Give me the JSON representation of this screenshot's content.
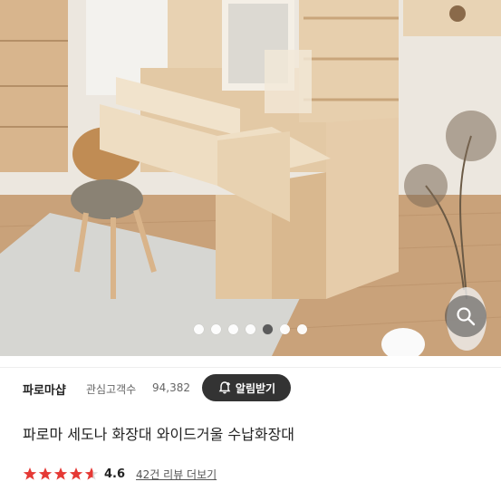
{
  "gallery": {
    "image_alt": "product-photo",
    "page_count": 7,
    "active_index": 4
  },
  "shop": {
    "name": "파로마샵",
    "fans_label": "관심고객수",
    "fans_count": "94,382",
    "alert_button_label": "알림받기"
  },
  "product": {
    "title": "파로마 세도나 화장대 와이드거울 수납화장대",
    "rating": "4.6",
    "rating_value": 4.6,
    "reviews_label": "42건 리뷰 더보기",
    "star_color": "#e53935"
  }
}
